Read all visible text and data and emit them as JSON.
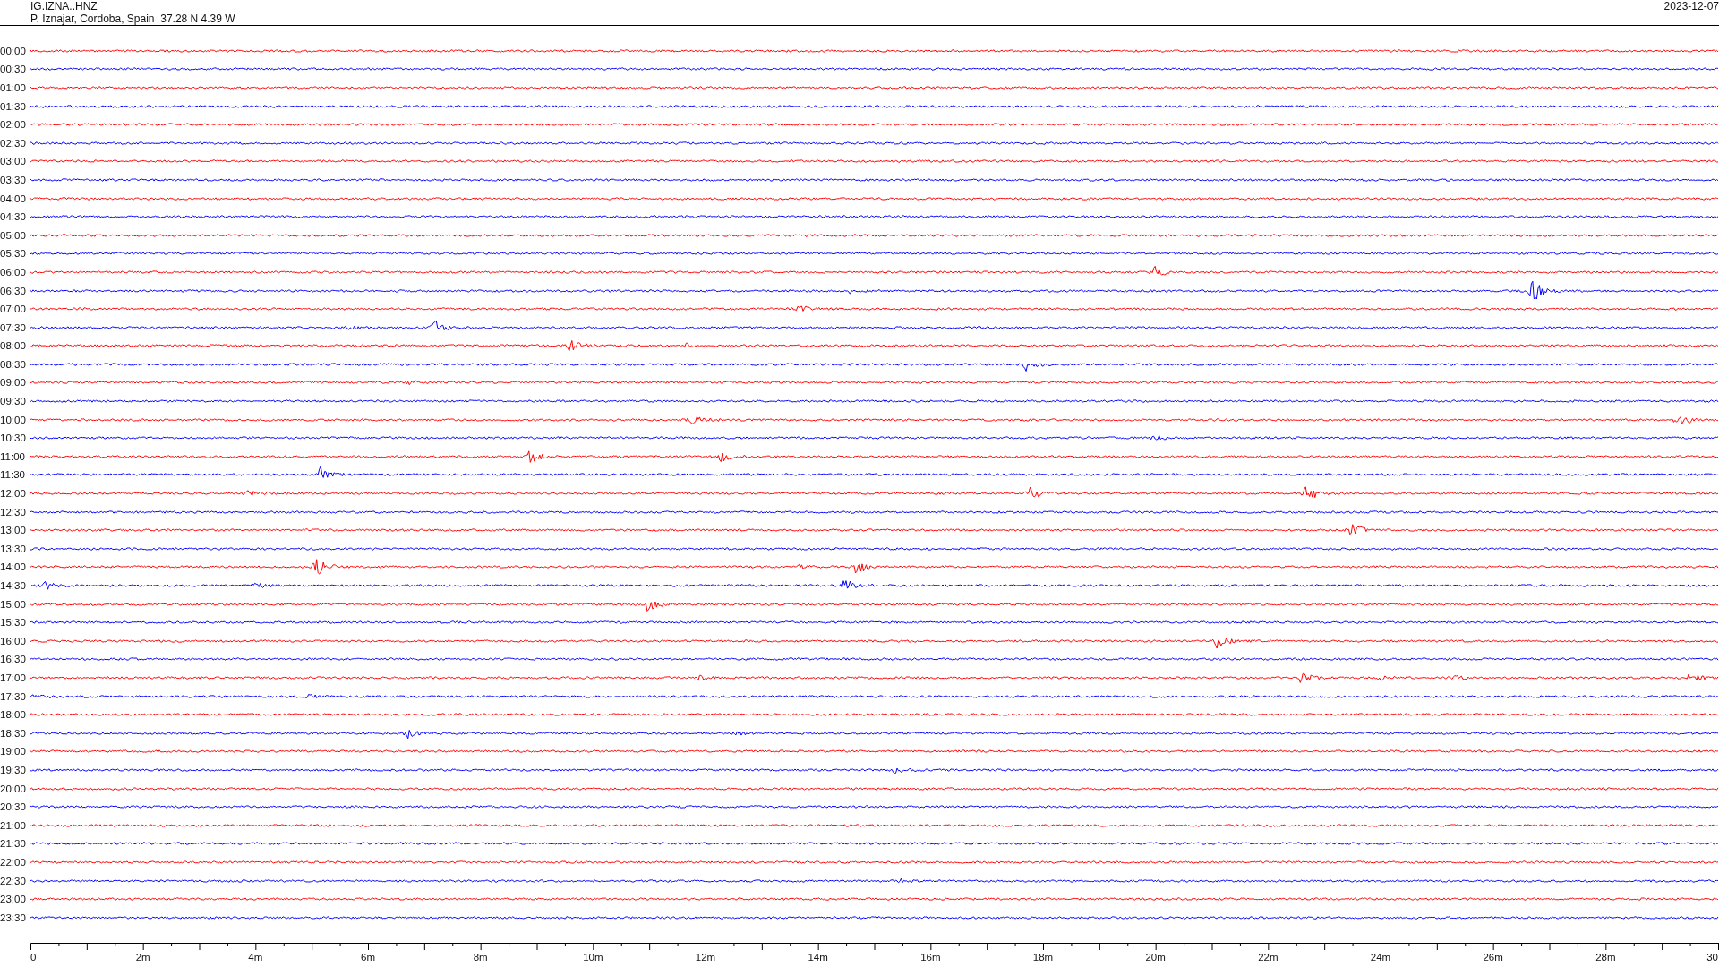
{
  "header": {
    "station": "IG.IZNA..HNZ",
    "location": "P. Iznajar, Cordoba, Spain  37.28 N 4.39 W",
    "date": "2023-12-07"
  },
  "traces": [
    {
      "label": "00:00",
      "color": "#ff0000"
    },
    {
      "label": "00:30",
      "color": "#0000ff"
    },
    {
      "label": "01:00",
      "color": "#ff0000"
    },
    {
      "label": "01:30",
      "color": "#0000ff"
    },
    {
      "label": "02:00",
      "color": "#ff0000"
    },
    {
      "label": "02:30",
      "color": "#0000ff"
    },
    {
      "label": "03:00",
      "color": "#ff0000"
    },
    {
      "label": "03:30",
      "color": "#0000ff"
    },
    {
      "label": "04:00",
      "color": "#ff0000"
    },
    {
      "label": "04:30",
      "color": "#0000ff"
    },
    {
      "label": "05:00",
      "color": "#ff0000"
    },
    {
      "label": "05:30",
      "color": "#0000ff"
    },
    {
      "label": "06:00",
      "color": "#ff0000"
    },
    {
      "label": "06:30",
      "color": "#0000ff"
    },
    {
      "label": "07:00",
      "color": "#ff0000"
    },
    {
      "label": "07:30",
      "color": "#0000ff"
    },
    {
      "label": "08:00",
      "color": "#ff0000"
    },
    {
      "label": "08:30",
      "color": "#0000ff"
    },
    {
      "label": "09:00",
      "color": "#ff0000"
    },
    {
      "label": "09:30",
      "color": "#0000ff"
    },
    {
      "label": "10:00",
      "color": "#ff0000"
    },
    {
      "label": "10:30",
      "color": "#0000ff"
    },
    {
      "label": "11:00",
      "color": "#ff0000"
    },
    {
      "label": "11:30",
      "color": "#0000ff"
    },
    {
      "label": "12:00",
      "color": "#ff0000"
    },
    {
      "label": "12:30",
      "color": "#0000ff"
    },
    {
      "label": "13:00",
      "color": "#ff0000"
    },
    {
      "label": "13:30",
      "color": "#0000ff"
    },
    {
      "label": "14:00",
      "color": "#ff0000"
    },
    {
      "label": "14:30",
      "color": "#0000ff"
    },
    {
      "label": "15:00",
      "color": "#ff0000"
    },
    {
      "label": "15:30",
      "color": "#0000ff"
    },
    {
      "label": "16:00",
      "color": "#ff0000"
    },
    {
      "label": "16:30",
      "color": "#0000ff"
    },
    {
      "label": "17:00",
      "color": "#ff0000"
    },
    {
      "label": "17:30",
      "color": "#0000ff"
    },
    {
      "label": "18:00",
      "color": "#ff0000"
    },
    {
      "label": "18:30",
      "color": "#0000ff"
    },
    {
      "label": "19:00",
      "color": "#ff0000"
    },
    {
      "label": "19:30",
      "color": "#0000ff"
    },
    {
      "label": "20:00",
      "color": "#ff0000"
    },
    {
      "label": "20:30",
      "color": "#0000ff"
    },
    {
      "label": "21:00",
      "color": "#ff0000"
    },
    {
      "label": "21:30",
      "color": "#0000ff"
    },
    {
      "label": "22:00",
      "color": "#ff0000"
    },
    {
      "label": "22:30",
      "color": "#0000ff"
    },
    {
      "label": "23:00",
      "color": "#ff0000"
    },
    {
      "label": "23:30",
      "color": "#0000ff"
    }
  ],
  "axis": {
    "labels": [
      "0",
      "2m",
      "4m",
      "6m",
      "8m",
      "10m",
      "12m",
      "14m",
      "16m",
      "18m",
      "20m",
      "22m",
      "24m",
      "26m",
      "28m",
      "30"
    ]
  }
}
